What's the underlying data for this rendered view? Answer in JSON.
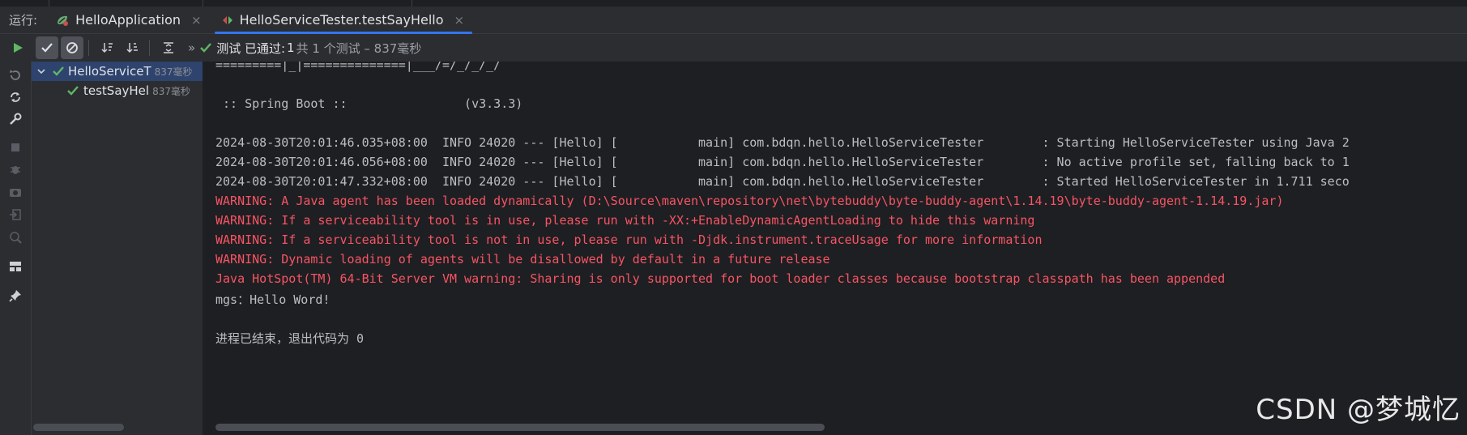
{
  "run_panel": {
    "label": "运行:",
    "tabs": [
      {
        "title": "HelloApplication",
        "icon": "spring-app-icon"
      },
      {
        "title": "HelloServiceTester.testSayHello",
        "icon": "test-run-icon",
        "active": true
      }
    ],
    "close_glyph": "×"
  },
  "toolbar": {
    "more_glyph": "»",
    "status_prefix": "测试 已通过:",
    "status_count": "1",
    "status_detail": "共 1 个测试 – 837毫秒"
  },
  "test_tree": [
    {
      "name": "HelloServiceT",
      "duration": "837毫秒",
      "level": 0,
      "expanded": true,
      "selected": true,
      "passed": true
    },
    {
      "name": "testSayHel",
      "duration": "837毫秒",
      "level": 1,
      "passed": true
    }
  ],
  "console": {
    "lines": [
      {
        "text": "=========|_|==============|___/=/_/_/_/",
        "warn": false
      },
      {
        "text": "",
        "warn": false
      },
      {
        "text": " :: Spring Boot ::                (v3.3.3)",
        "warn": false
      },
      {
        "text": "",
        "warn": false
      },
      {
        "text": "2024-08-30T20:01:46.035+08:00  INFO 24020 --- [Hello] [           main] com.bdqn.hello.HelloServiceTester        : Starting HelloServiceTester using Java 2",
        "warn": false
      },
      {
        "text": "2024-08-30T20:01:46.056+08:00  INFO 24020 --- [Hello] [           main] com.bdqn.hello.HelloServiceTester        : No active profile set, falling back to 1",
        "warn": false
      },
      {
        "text": "2024-08-30T20:01:47.332+08:00  INFO 24020 --- [Hello] [           main] com.bdqn.hello.HelloServiceTester        : Started HelloServiceTester in 1.711 seco",
        "warn": false
      },
      {
        "text": "WARNING: A Java agent has been loaded dynamically (D:\\Source\\maven\\repository\\net\\bytebuddy\\byte-buddy-agent\\1.14.19\\byte-buddy-agent-1.14.19.jar)",
        "warn": true
      },
      {
        "text": "WARNING: If a serviceability tool is in use, please run with -XX:+EnableDynamicAgentLoading to hide this warning",
        "warn": true
      },
      {
        "text": "WARNING: If a serviceability tool is not in use, please run with -Djdk.instrument.traceUsage for more information",
        "warn": true
      },
      {
        "text": "WARNING: Dynamic loading of agents will be disallowed by default in a future release",
        "warn": true
      },
      {
        "text": "Java HotSpot(TM) 64-Bit Server VM warning: Sharing is only supported for boot loader classes because bootstrap classpath has been appended",
        "warn": true
      },
      {
        "text": "mgs：Hello Word!",
        "warn": false
      },
      {
        "text": "",
        "warn": false
      },
      {
        "text": "进程已结束，退出代码为 0",
        "warn": false
      }
    ]
  },
  "watermark": "CSDN @梦城忆",
  "colors": {
    "pass_green": "#5fb865",
    "warning_red": "#f75464",
    "tab_underline": "#3574f0",
    "selection": "#2e436e"
  }
}
